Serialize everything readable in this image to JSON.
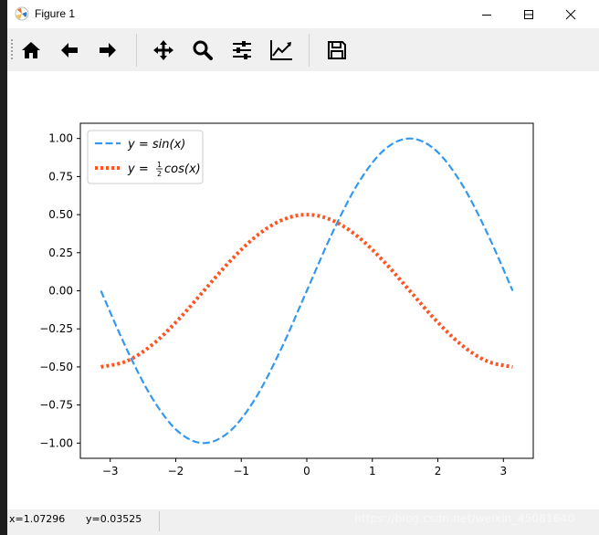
{
  "window": {
    "title": "Figure 1",
    "controls": [
      "minimize",
      "maximize",
      "close"
    ]
  },
  "toolbar": {
    "buttons": [
      {
        "name": "home",
        "icon": "home-icon"
      },
      {
        "name": "back",
        "icon": "arrow-left-icon"
      },
      {
        "name": "forward",
        "icon": "arrow-right-icon"
      },
      {
        "name": "pan",
        "icon": "move-icon"
      },
      {
        "name": "zoom",
        "icon": "magnifier-icon"
      },
      {
        "name": "configure",
        "icon": "sliders-icon"
      },
      {
        "name": "edit-axes",
        "icon": "line-chart-icon"
      },
      {
        "name": "save",
        "icon": "floppy-disk-icon"
      }
    ]
  },
  "status": {
    "x": "x=1.07296",
    "y": "y=0.03525",
    "watermark": "https://blog.csdn.net/weixin_45081640"
  },
  "colors": {
    "sin": "#3399ee",
    "cos": "#ff5522",
    "toolbar_bg": "#f0f0f0"
  },
  "chart_data": {
    "type": "line",
    "title": "",
    "xlabel": "",
    "ylabel": "",
    "xlim": [
      -3.4558,
      3.4558
    ],
    "ylim": [
      -1.1,
      1.1
    ],
    "xticks": [
      "−3",
      "−2",
      "−1",
      "0",
      "1",
      "2",
      "3"
    ],
    "xtick_values": [
      -3,
      -2,
      -1,
      0,
      1,
      2,
      3
    ],
    "yticks": [
      "−1.00",
      "−0.75",
      "−0.50",
      "−0.25",
      "0.00",
      "0.25",
      "0.50",
      "0.75",
      "1.00"
    ],
    "ytick_values": [
      -1.0,
      -0.75,
      -0.5,
      -0.25,
      0.0,
      0.25,
      0.5,
      0.75,
      1.0
    ],
    "grid": false,
    "legend_position": "upper-left",
    "series": [
      {
        "name": "y = sin(x)",
        "legend_label": {
          "y": "y",
          "eq": " = ",
          "fn": "sin",
          "arg": "(x)"
        },
        "style": "dashed",
        "x": [
          -3.1416,
          -2.7489,
          -2.3562,
          -1.9635,
          -1.5708,
          -1.1781,
          -0.7854,
          -0.3927,
          0.0,
          0.3927,
          0.7854,
          1.1781,
          1.5708,
          1.9635,
          2.3562,
          2.7489,
          3.1416
        ],
        "y": [
          0.0,
          -0.3827,
          -0.7071,
          -0.9239,
          -1.0,
          -0.9239,
          -0.7071,
          -0.3827,
          0.0,
          0.3827,
          0.7071,
          0.9239,
          1.0,
          0.9239,
          0.7071,
          0.3827,
          0.0
        ]
      },
      {
        "name": "y = ½cos(x)",
        "legend_label": {
          "y": "y",
          "eq": " = ",
          "num": "1",
          "den": "2",
          "fn": "cos",
          "arg": "(x)"
        },
        "style": "dotted",
        "x": [
          -3.1416,
          -2.7489,
          -2.3562,
          -1.9635,
          -1.5708,
          -1.1781,
          -0.7854,
          -0.3927,
          0.0,
          0.3927,
          0.7854,
          1.1781,
          1.5708,
          1.9635,
          2.3562,
          2.7489,
          3.1416
        ],
        "y": [
          -0.5,
          -0.4619,
          -0.3536,
          -0.1913,
          0.0,
          0.1913,
          0.3536,
          0.4619,
          0.5,
          0.4619,
          0.3536,
          0.1913,
          0.0,
          -0.1913,
          -0.3536,
          -0.4619,
          -0.5
        ]
      }
    ]
  }
}
